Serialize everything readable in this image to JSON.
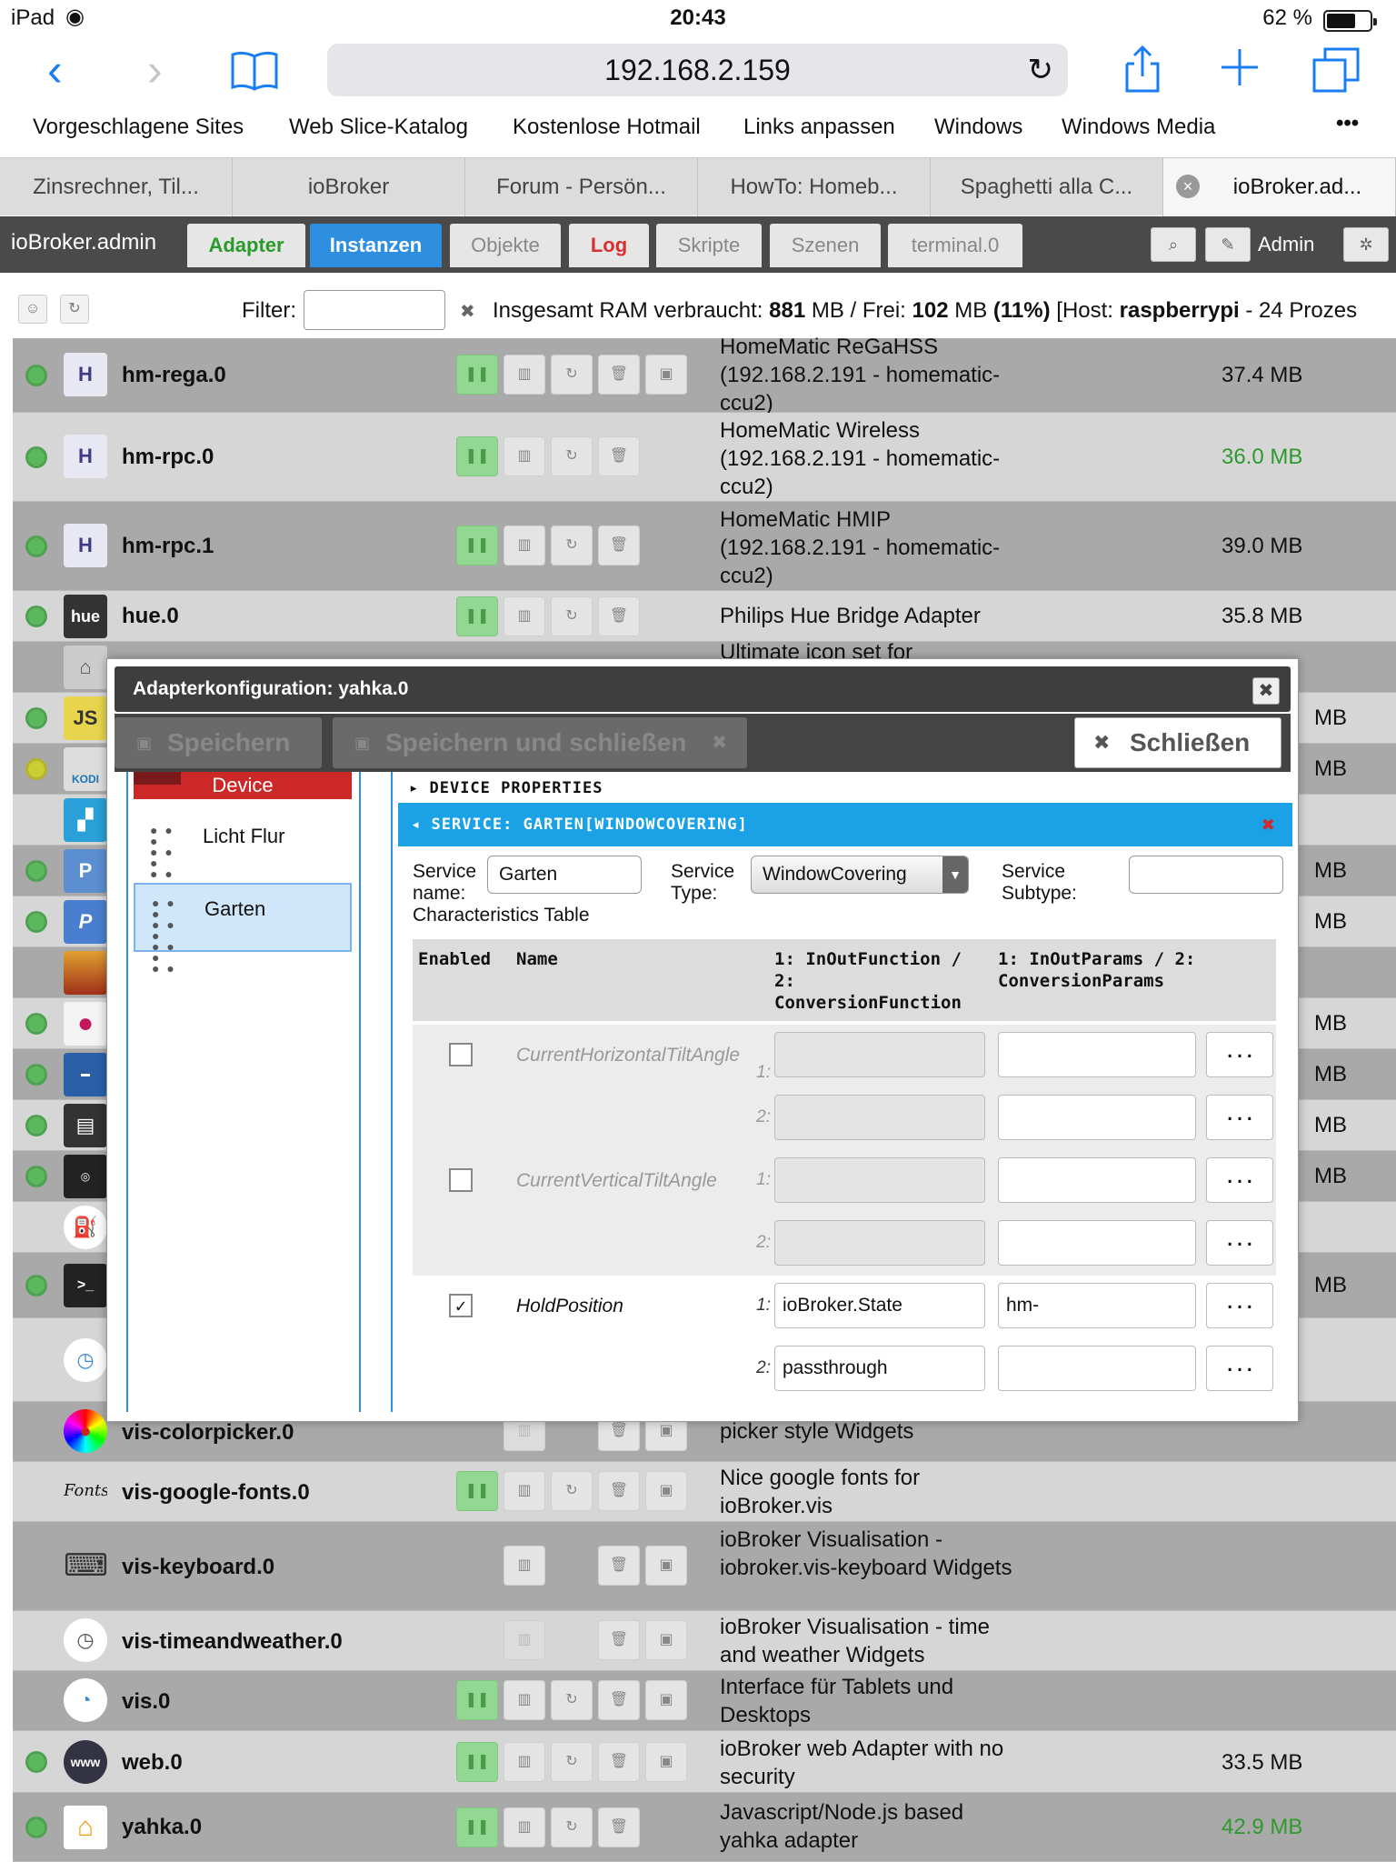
{
  "status": {
    "device": "iPad",
    "time": "20:43",
    "battery": "62 %"
  },
  "browser": {
    "url": "192.168.2.159",
    "favorites": [
      "Vorgeschlagene Sites",
      "Web Slice-Katalog",
      "Kostenlose Hotmail",
      "Links anpassen",
      "Windows",
      "Windows Media",
      "•••"
    ],
    "tabs": [
      "Zinsrechner, Til...",
      "ioBroker",
      "Forum - Persön...",
      "HowTo: Homeb...",
      "Spaghetti alla C...",
      "ioBroker.ad..."
    ]
  },
  "app": {
    "brand": "ioBroker.admin",
    "tabs": [
      "Adapter",
      "Instanzen",
      "Objekte",
      "Log",
      "Skripte",
      "Szenen",
      "terminal.0"
    ],
    "user": "Admin"
  },
  "filter": {
    "label": "Filter:",
    "ram_prefix": "Insgesamt RAM verbraucht: ",
    "ram_used": "881",
    "ram_free_prefix": " MB / Frei: ",
    "ram_free": "102",
    "ram_mid": " MB ",
    "ram_pct": "(11%)",
    "host_prefix": " [Host: ",
    "host": "raspberrypi",
    "host_suffix": " - 24 Prozes"
  },
  "rows": [
    {
      "name": "hm-rega.0",
      "desc": "HomeMatic ReGaHSS (192.168.2.191 - homematic-ccu2)",
      "mem": "37.4 MB",
      "icon": "H"
    },
    {
      "name": "hm-rpc.0",
      "desc": "HomeMatic Wireless (192.168.2.191 - homematic-ccu2)",
      "mem": "36.0 MB",
      "icon": "H"
    },
    {
      "name": "hm-rpc.1",
      "desc": "HomeMatic HMIP (192.168.2.191 - homematic-ccu2)",
      "mem": "39.0 MB",
      "icon": "H"
    },
    {
      "name": "hue.0",
      "desc": "Philips Hue Bridge Adapter",
      "mem": "35.8 MB",
      "icon": "hue"
    },
    {
      "name": "vis-colorpicker.0",
      "desc": "ioBroker Visualisation - color picker style Widgets",
      "mem": "",
      "icon": "●"
    },
    {
      "name": "vis-google-fonts.0",
      "desc": "Nice google fonts for ioBroker.vis",
      "mem": "",
      "icon": "Fonts"
    },
    {
      "name": "vis-keyboard.0",
      "desc": "ioBroker Visualisation - iobroker.vis-keyboard Widgets",
      "mem": "",
      "icon": "⌨"
    },
    {
      "name": "vis-timeandweather.0",
      "desc": "ioBroker Visualisation - time and weather Widgets",
      "mem": "",
      "icon": "◷"
    },
    {
      "name": "vis.0",
      "desc": "Interface für Tablets und Desktops",
      "mem": "",
      "icon": "◔"
    },
    {
      "name": "web.0",
      "desc": "ioBroker web Adapter with no security",
      "mem": "33.5 MB",
      "icon": "www"
    },
    {
      "name": "yahka.0",
      "desc": "Javascript/Node.js based yahka adapter",
      "mem": "42.9 MB",
      "icon": "⌂"
    }
  ],
  "side_mem": [
    "MB",
    "MB",
    "MB",
    "MB",
    "MB",
    "MB",
    "MB",
    "MB",
    "MB"
  ],
  "side_desc_stub": "Ultimate icon set for",
  "side_icons": [
    "JS",
    "KODI",
    "P",
    "P"
  ],
  "modal": {
    "title": "Adapterkonfiguration: yahka.0",
    "save": "Speichern",
    "save_close": "Speichern und schließen",
    "close": "Schließen",
    "device_tag": "Device",
    "sidebar": [
      "Licht Flur",
      "Garten"
    ],
    "device_properties": "DEVICE PROPERTIES",
    "service_header": "SERVICE: GARTEN[WINDOWCOVERING]",
    "service_name_label": "Service name:",
    "service_name": "Garten",
    "service_type_label": "Service Type:",
    "service_type": "WindowCovering",
    "service_subtype_label": "Service Subtype:",
    "service_subtype": "",
    "char_table_label": "Characteristics Table",
    "columns": [
      "Enabled",
      "Name",
      "1: InOutFunction / 2: ConversionFunction",
      "1: InOutParams / 2: ConversionParams"
    ],
    "characteristics": [
      {
        "name": "CurrentHorizontalTiltAngle",
        "enabled": false,
        "f1": "",
        "p1": "",
        "f2": "",
        "p2": ""
      },
      {
        "name": "CurrentVerticalTiltAngle",
        "enabled": false,
        "f1": "",
        "p1": "",
        "f2": "",
        "p2": ""
      },
      {
        "name": "HoldPosition",
        "enabled": true,
        "f1": "ioBroker.State",
        "p1": "hm-",
        "f2": "passthrough",
        "p2": ""
      }
    ],
    "idx1": "1:",
    "idx2": "2:",
    "dots": "..."
  }
}
